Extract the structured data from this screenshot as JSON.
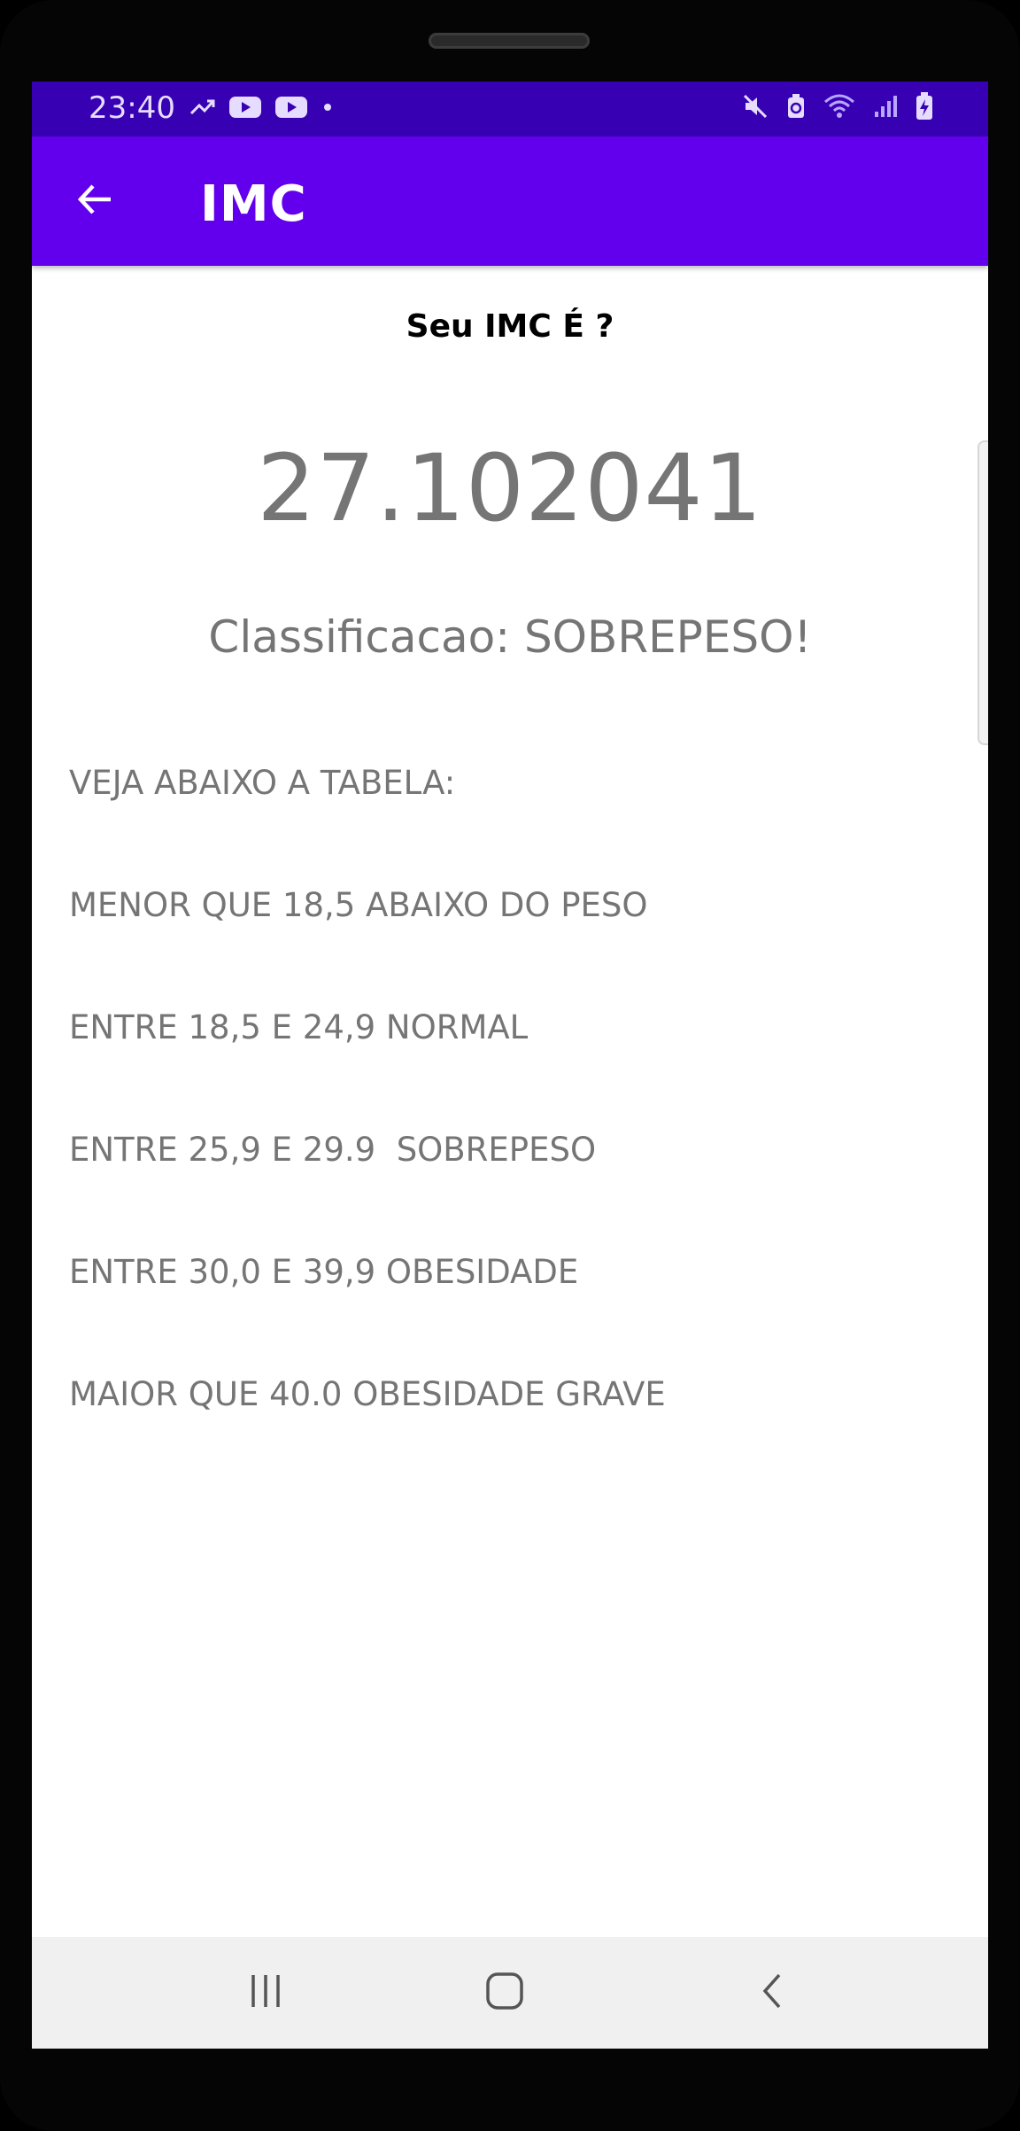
{
  "status_bar": {
    "time": "23:40",
    "left_icons": [
      "trending-up-icon",
      "youtube-icon",
      "youtube-icon",
      "notification-dot-icon"
    ],
    "right_icons": [
      "mute-icon",
      "battery-saver-icon",
      "wifi-icon",
      "signal-icon",
      "battery-charging-icon"
    ]
  },
  "app_bar": {
    "title": "IMC",
    "back_icon": "arrow-back-icon"
  },
  "result": {
    "heading": "Seu IMC É ?",
    "value": "27.102041",
    "classification": "Classificacao: SOBREPESO!"
  },
  "table": {
    "intro": "VEJA ABAIXO A TABELA:",
    "rows": [
      "MENOR QUE 18,5 ABAIXO DO PESO",
      "ENTRE 18,5 E 24,9 NORMAL",
      "ENTRE 25,9 E 29.9  SOBREPESO",
      "ENTRE 30,0 E 39,9 OBESIDADE",
      "MAIOR QUE 40.0 OBESIDADE GRAVE"
    ]
  },
  "nav_bar": {
    "icons": [
      "recent-apps-icon",
      "home-icon",
      "back-icon"
    ]
  },
  "colors": {
    "status_bar": "#3700b3",
    "app_bar": "#6200ee",
    "secondary_text": "#757575",
    "nav_bar": "#f0f0f0"
  }
}
